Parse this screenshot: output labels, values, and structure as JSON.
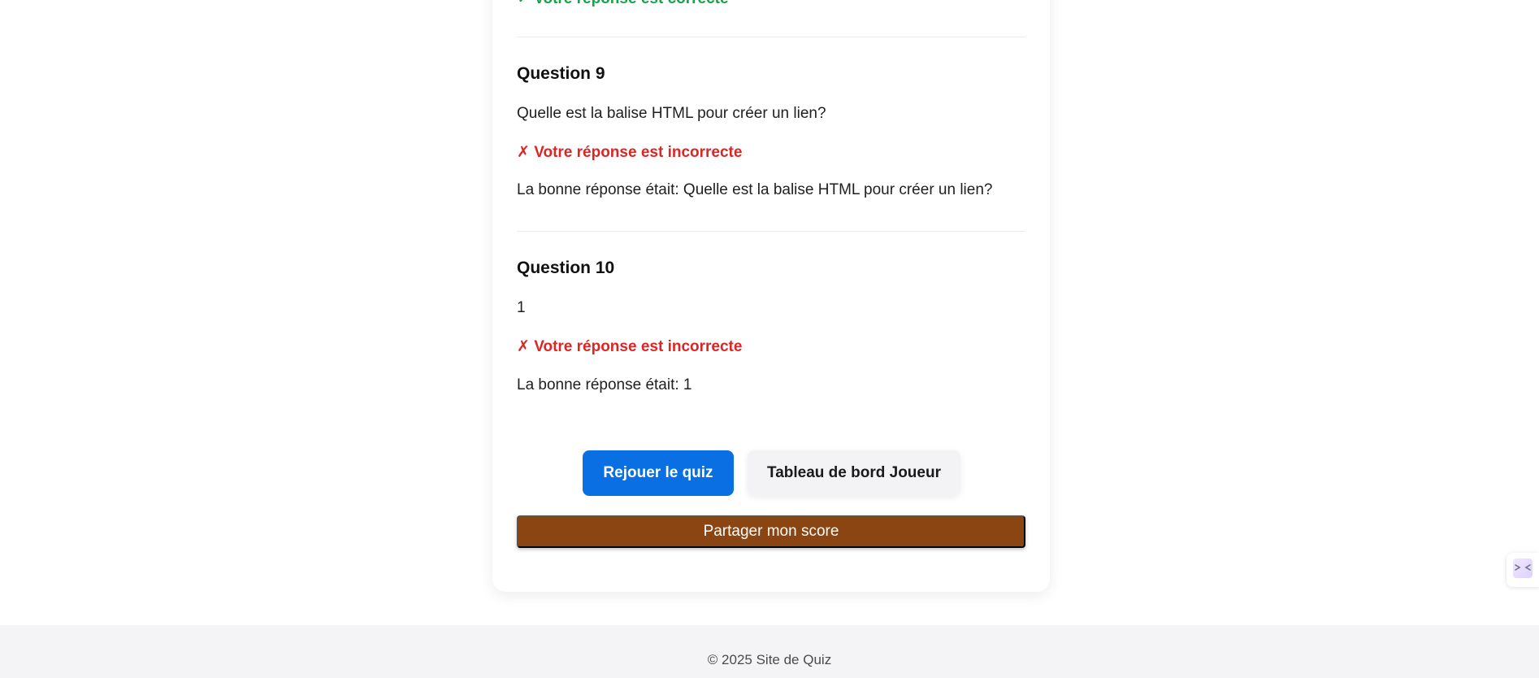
{
  "previous_question": {
    "result_text": "✓ Votre réponse est correcte"
  },
  "questions": [
    {
      "title": "Question 9",
      "text": "Quelle est la balise HTML pour créer un lien?",
      "result": "✗ Votre réponse est incorrecte",
      "correct_answer": "La bonne réponse était: Quelle est la balise HTML pour créer un lien?"
    },
    {
      "title": "Question 10",
      "text": "1",
      "result": "✗ Votre réponse est incorrecte",
      "correct_answer": "La bonne réponse était: 1"
    }
  ],
  "actions": {
    "replay_label": "Rejouer le quiz",
    "dashboard_label": "Tableau de bord Joueur",
    "share_label": "Partager mon score"
  },
  "footer": {
    "text": "© 2025 Site de Quiz"
  },
  "side_widget": {
    "icon": "collapse-arrows-icon"
  },
  "colors": {
    "correct": "#16a34a",
    "incorrect": "#dc2626",
    "primary_button": "#0a6fe3",
    "share_button": "#8b4513"
  }
}
